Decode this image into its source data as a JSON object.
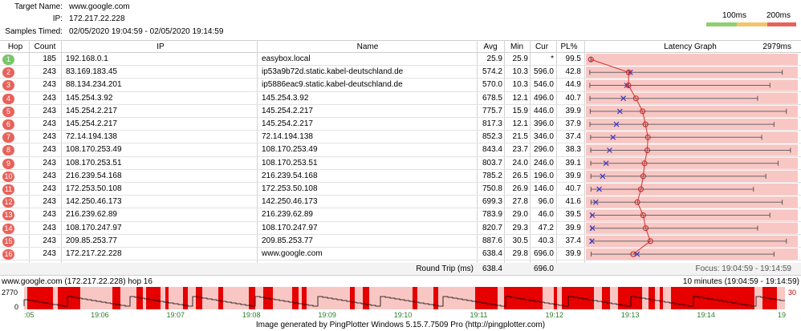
{
  "info": {
    "target_label": "Target Name:",
    "target_value": "www.google.com",
    "ip_label": "IP:",
    "ip_value": "172.217.22.228",
    "samples_label": "Samples Timed:",
    "samples_value": "02/05/2020 19:04:59 - 02/05/2020 19:14:59"
  },
  "legend": {
    "label_100": "100ms",
    "label_200": "200ms",
    "colors": [
      "#8fcf6f",
      "#f5c46a",
      "#e8625a"
    ]
  },
  "columns": {
    "hop": "Hop",
    "count": "Count",
    "ip": "IP",
    "name": "Name",
    "avg": "Avg",
    "min": "Min",
    "cur": "Cur",
    "pl": "PL%",
    "graph": "Latency Graph",
    "graph_max": "2979ms"
  },
  "hops": [
    {
      "hop": "1",
      "count": "185",
      "ip": "192.168.0.1",
      "name": "easybox.local",
      "avg": "25.9",
      "min": "25.9",
      "cur": "*",
      "pl": "99.5",
      "color": "#7cc56a"
    },
    {
      "hop": "2",
      "count": "243",
      "ip": "83.169.183.45",
      "name": "ip53a9b72d.static.kabel-deutschland.de",
      "avg": "574.2",
      "min": "10.3",
      "cur": "596.0",
      "pl": "42.8",
      "color": "#e8625a"
    },
    {
      "hop": "3",
      "count": "243",
      "ip": "88.134.234.201",
      "name": "ip5886eac9.static.kabel-deutschland.de",
      "avg": "570.0",
      "min": "10.3",
      "cur": "546.0",
      "pl": "44.9",
      "color": "#e8625a"
    },
    {
      "hop": "4",
      "count": "243",
      "ip": "145.254.3.92",
      "name": "145.254.3.92",
      "avg": "678.5",
      "min": "12.1",
      "cur": "496.0",
      "pl": "40.7",
      "color": "#e8625a"
    },
    {
      "hop": "5",
      "count": "243",
      "ip": "145.254.2.217",
      "name": "145.254.2.217",
      "avg": "775.7",
      "min": "15.9",
      "cur": "446.0",
      "pl": "39.9",
      "color": "#e8625a"
    },
    {
      "hop": "6",
      "count": "243",
      "ip": "145.254.2.217",
      "name": "145.254.2.217",
      "avg": "817.3",
      "min": "12.1",
      "cur": "396.0",
      "pl": "37.9",
      "color": "#e8625a"
    },
    {
      "hop": "7",
      "count": "243",
      "ip": "72.14.194.138",
      "name": "72.14.194.138",
      "avg": "852.3",
      "min": "21.5",
      "cur": "346.0",
      "pl": "37.4",
      "color": "#e8625a"
    },
    {
      "hop": "8",
      "count": "243",
      "ip": "108.170.253.49",
      "name": "108.170.253.49",
      "avg": "843.4",
      "min": "23.7",
      "cur": "296.0",
      "pl": "38.3",
      "color": "#e8625a"
    },
    {
      "hop": "9",
      "count": "243",
      "ip": "108.170.253.51",
      "name": "108.170.253.51",
      "avg": "803.7",
      "min": "24.0",
      "cur": "246.0",
      "pl": "39.1",
      "color": "#e8625a"
    },
    {
      "hop": "10",
      "count": "243",
      "ip": "216.239.54.168",
      "name": "216.239.54.168",
      "avg": "785.2",
      "min": "26.5",
      "cur": "196.0",
      "pl": "39.9",
      "color": "#e8625a"
    },
    {
      "hop": "11",
      "count": "243",
      "ip": "172.253.50.108",
      "name": "172.253.50.108",
      "avg": "750.8",
      "min": "26.9",
      "cur": "146.0",
      "pl": "40.7",
      "color": "#e8625a"
    },
    {
      "hop": "12",
      "count": "243",
      "ip": "142.250.46.173",
      "name": "142.250.46.173",
      "avg": "699.3",
      "min": "27.8",
      "cur": "96.0",
      "pl": "41.6",
      "color": "#e8625a"
    },
    {
      "hop": "13",
      "count": "243",
      "ip": "216.239.62.89",
      "name": "216.239.62.89",
      "avg": "783.9",
      "min": "29.0",
      "cur": "46.0",
      "pl": "39.5",
      "color": "#e8625a"
    },
    {
      "hop": "14",
      "count": "243",
      "ip": "108.170.247.97",
      "name": "108.170.247.97",
      "avg": "820.7",
      "min": "29.3",
      "cur": "47.2",
      "pl": "39.9",
      "color": "#e8625a"
    },
    {
      "hop": "15",
      "count": "243",
      "ip": "209.85.253.77",
      "name": "209.85.253.77",
      "avg": "887.6",
      "min": "30.5",
      "cur": "40.3",
      "pl": "37.4",
      "color": "#e8625a"
    },
    {
      "hop": "16",
      "count": "243",
      "ip": "172.217.22.228",
      "name": "www.google.com",
      "avg": "638.4",
      "min": "29.8",
      "cur": "696.0",
      "pl": "39.9",
      "color": "#e8625a"
    }
  ],
  "roundtrip": {
    "label": "Round Trip (ms)",
    "avg": "638.4",
    "cur": "696.0",
    "focus": "Focus: 19:04:59 - 19:14:59"
  },
  "timeline": {
    "title": "www.google.com (172.217.22.228) hop 16",
    "range": "10 minutes (19:04:59 - 19:14:59)",
    "y_max": "2770",
    "y_zero": "0",
    "right_label": "30",
    "times": [
      ":05",
      "19:06",
      "19:07",
      "19:08",
      "19:09",
      "19:10",
      "19:11",
      "19:12",
      "19:13",
      "19:14",
      "19"
    ]
  },
  "footer": "Image generated by PingPlotter Windows 5.15.7.7509 Pro (http://pingplotter.com)"
}
